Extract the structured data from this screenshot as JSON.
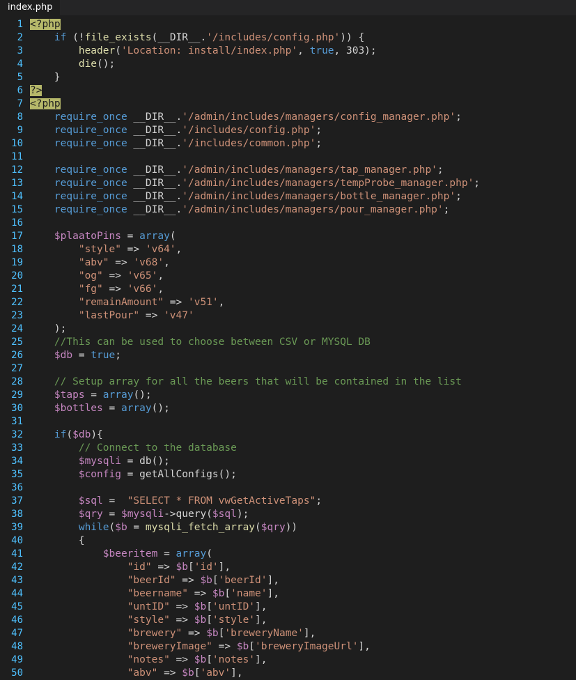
{
  "tab": {
    "title": "index.php"
  },
  "colors": {
    "background": "#1e1e1e",
    "tabbar": "#252526",
    "line_number": "#4fc1ff",
    "tag_highlight": "#b6b86a",
    "keyword": "#569cd6",
    "variable": "#c586c0",
    "function": "#dcdcaa",
    "string": "#ce9178",
    "comment": "#6a9955",
    "text": "#d4d4d4"
  },
  "lines": [
    {
      "n": "1",
      "tokens": [
        {
          "t": "tag",
          "v": "<?php"
        }
      ]
    },
    {
      "n": "2",
      "tokens": [
        {
          "t": "p",
          "v": "    "
        },
        {
          "t": "kw",
          "v": "if"
        },
        {
          "t": "p",
          "v": " (!"
        },
        {
          "t": "fn",
          "v": "file_exists"
        },
        {
          "t": "p",
          "v": "(__DIR__."
        },
        {
          "t": "str",
          "v": "'/includes/config.php'"
        },
        {
          "t": "p",
          "v": ")) {"
        }
      ]
    },
    {
      "n": "3",
      "tokens": [
        {
          "t": "p",
          "v": "        "
        },
        {
          "t": "fn",
          "v": "header"
        },
        {
          "t": "p",
          "v": "("
        },
        {
          "t": "str",
          "v": "'Location: install/index.php'"
        },
        {
          "t": "p",
          "v": ", "
        },
        {
          "t": "kw",
          "v": "true"
        },
        {
          "t": "p",
          "v": ", 303);"
        }
      ]
    },
    {
      "n": "4",
      "tokens": [
        {
          "t": "p",
          "v": "        "
        },
        {
          "t": "fn",
          "v": "die"
        },
        {
          "t": "p",
          "v": "();"
        }
      ]
    },
    {
      "n": "5",
      "tokens": [
        {
          "t": "p",
          "v": "    }"
        }
      ]
    },
    {
      "n": "6",
      "tokens": [
        {
          "t": "tag",
          "v": "?>"
        }
      ]
    },
    {
      "n": "7",
      "tokens": [
        {
          "t": "tag",
          "v": "<?php"
        }
      ]
    },
    {
      "n": "8",
      "tokens": [
        {
          "t": "p",
          "v": "    "
        },
        {
          "t": "kw",
          "v": "require_once"
        },
        {
          "t": "p",
          "v": " __DIR__."
        },
        {
          "t": "str",
          "v": "'/admin/includes/managers/config_manager.php'"
        },
        {
          "t": "p",
          "v": ";"
        }
      ]
    },
    {
      "n": "9",
      "tokens": [
        {
          "t": "p",
          "v": "    "
        },
        {
          "t": "kw",
          "v": "require_once"
        },
        {
          "t": "p",
          "v": " __DIR__."
        },
        {
          "t": "str",
          "v": "'/includes/config.php'"
        },
        {
          "t": "p",
          "v": ";"
        }
      ]
    },
    {
      "n": "10",
      "tokens": [
        {
          "t": "p",
          "v": "    "
        },
        {
          "t": "kw",
          "v": "require_once"
        },
        {
          "t": "p",
          "v": " __DIR__."
        },
        {
          "t": "str",
          "v": "'/includes/common.php'"
        },
        {
          "t": "p",
          "v": ";"
        }
      ]
    },
    {
      "n": "11",
      "tokens": []
    },
    {
      "n": "12",
      "tokens": [
        {
          "t": "p",
          "v": "    "
        },
        {
          "t": "kw",
          "v": "require_once"
        },
        {
          "t": "p",
          "v": " __DIR__."
        },
        {
          "t": "str",
          "v": "'/admin/includes/managers/tap_manager.php'"
        },
        {
          "t": "p",
          "v": ";"
        }
      ]
    },
    {
      "n": "13",
      "tokens": [
        {
          "t": "p",
          "v": "    "
        },
        {
          "t": "kw",
          "v": "require_once"
        },
        {
          "t": "p",
          "v": " __DIR__."
        },
        {
          "t": "str",
          "v": "'/admin/includes/managers/tempProbe_manager.php'"
        },
        {
          "t": "p",
          "v": ";"
        }
      ]
    },
    {
      "n": "14",
      "tokens": [
        {
          "t": "p",
          "v": "    "
        },
        {
          "t": "kw",
          "v": "require_once"
        },
        {
          "t": "p",
          "v": " __DIR__."
        },
        {
          "t": "str",
          "v": "'/admin/includes/managers/bottle_manager.php'"
        },
        {
          "t": "p",
          "v": ";"
        }
      ]
    },
    {
      "n": "15",
      "tokens": [
        {
          "t": "p",
          "v": "    "
        },
        {
          "t": "kw",
          "v": "require_once"
        },
        {
          "t": "p",
          "v": " __DIR__."
        },
        {
          "t": "str",
          "v": "'/admin/includes/managers/pour_manager.php'"
        },
        {
          "t": "p",
          "v": ";"
        }
      ]
    },
    {
      "n": "16",
      "tokens": []
    },
    {
      "n": "17",
      "tokens": [
        {
          "t": "p",
          "v": "    "
        },
        {
          "t": "var",
          "v": "$plaatoPins"
        },
        {
          "t": "p",
          "v": " = "
        },
        {
          "t": "kw",
          "v": "array"
        },
        {
          "t": "p",
          "v": "("
        }
      ]
    },
    {
      "n": "18",
      "tokens": [
        {
          "t": "p",
          "v": "        "
        },
        {
          "t": "str",
          "v": "\"style\""
        },
        {
          "t": "p",
          "v": " => "
        },
        {
          "t": "str",
          "v": "'v64'"
        },
        {
          "t": "p",
          "v": ","
        }
      ]
    },
    {
      "n": "19",
      "tokens": [
        {
          "t": "p",
          "v": "        "
        },
        {
          "t": "str",
          "v": "\"abv\""
        },
        {
          "t": "p",
          "v": " => "
        },
        {
          "t": "str",
          "v": "'v68'"
        },
        {
          "t": "p",
          "v": ","
        }
      ]
    },
    {
      "n": "20",
      "tokens": [
        {
          "t": "p",
          "v": "        "
        },
        {
          "t": "str",
          "v": "\"og\""
        },
        {
          "t": "p",
          "v": " => "
        },
        {
          "t": "str",
          "v": "'v65'"
        },
        {
          "t": "p",
          "v": ","
        }
      ]
    },
    {
      "n": "21",
      "tokens": [
        {
          "t": "p",
          "v": "        "
        },
        {
          "t": "str",
          "v": "\"fg\""
        },
        {
          "t": "p",
          "v": " => "
        },
        {
          "t": "str",
          "v": "'v66'"
        },
        {
          "t": "p",
          "v": ","
        }
      ]
    },
    {
      "n": "22",
      "tokens": [
        {
          "t": "p",
          "v": "        "
        },
        {
          "t": "str",
          "v": "\"remainAmount\""
        },
        {
          "t": "p",
          "v": " => "
        },
        {
          "t": "str",
          "v": "'v51'"
        },
        {
          "t": "p",
          "v": ","
        }
      ]
    },
    {
      "n": "23",
      "tokens": [
        {
          "t": "p",
          "v": "        "
        },
        {
          "t": "str",
          "v": "\"lastPour\""
        },
        {
          "t": "p",
          "v": " => "
        },
        {
          "t": "str",
          "v": "'v47'"
        }
      ]
    },
    {
      "n": "24",
      "tokens": [
        {
          "t": "p",
          "v": "    );"
        }
      ]
    },
    {
      "n": "25",
      "tokens": [
        {
          "t": "p",
          "v": "    "
        },
        {
          "t": "com",
          "v": "//This can be used to choose between CSV or MYSQL DB"
        }
      ]
    },
    {
      "n": "26",
      "tokens": [
        {
          "t": "p",
          "v": "    "
        },
        {
          "t": "var",
          "v": "$db"
        },
        {
          "t": "p",
          "v": " = "
        },
        {
          "t": "kw",
          "v": "true"
        },
        {
          "t": "p",
          "v": ";"
        }
      ]
    },
    {
      "n": "27",
      "tokens": []
    },
    {
      "n": "28",
      "tokens": [
        {
          "t": "p",
          "v": "    "
        },
        {
          "t": "com",
          "v": "// Setup array for all the beers that will be contained in the list"
        }
      ]
    },
    {
      "n": "29",
      "tokens": [
        {
          "t": "p",
          "v": "    "
        },
        {
          "t": "var",
          "v": "$taps"
        },
        {
          "t": "p",
          "v": " = "
        },
        {
          "t": "kw",
          "v": "array"
        },
        {
          "t": "p",
          "v": "();"
        }
      ]
    },
    {
      "n": "30",
      "tokens": [
        {
          "t": "p",
          "v": "    "
        },
        {
          "t": "var",
          "v": "$bottles"
        },
        {
          "t": "p",
          "v": " = "
        },
        {
          "t": "kw",
          "v": "array"
        },
        {
          "t": "p",
          "v": "();"
        }
      ]
    },
    {
      "n": "31",
      "tokens": []
    },
    {
      "n": "32",
      "tokens": [
        {
          "t": "p",
          "v": "    "
        },
        {
          "t": "kw",
          "v": "if"
        },
        {
          "t": "p",
          "v": "("
        },
        {
          "t": "var",
          "v": "$db"
        },
        {
          "t": "p",
          "v": "){"
        }
      ]
    },
    {
      "n": "33",
      "tokens": [
        {
          "t": "p",
          "v": "        "
        },
        {
          "t": "com",
          "v": "// Connect to the database"
        }
      ]
    },
    {
      "n": "34",
      "tokens": [
        {
          "t": "p",
          "v": "        "
        },
        {
          "t": "var",
          "v": "$mysqli"
        },
        {
          "t": "p",
          "v": " = db();"
        }
      ]
    },
    {
      "n": "35",
      "tokens": [
        {
          "t": "p",
          "v": "        "
        },
        {
          "t": "var",
          "v": "$config"
        },
        {
          "t": "p",
          "v": " = getAllConfigs();"
        }
      ]
    },
    {
      "n": "36",
      "tokens": []
    },
    {
      "n": "37",
      "tokens": [
        {
          "t": "p",
          "v": "        "
        },
        {
          "t": "var",
          "v": "$sql"
        },
        {
          "t": "p",
          "v": " =  "
        },
        {
          "t": "str",
          "v": "\"SELECT * FROM vwGetActiveTaps\""
        },
        {
          "t": "p",
          "v": ";"
        }
      ]
    },
    {
      "n": "38",
      "tokens": [
        {
          "t": "p",
          "v": "        "
        },
        {
          "t": "var",
          "v": "$qry"
        },
        {
          "t": "p",
          "v": " = "
        },
        {
          "t": "var",
          "v": "$mysqli"
        },
        {
          "t": "p",
          "v": "->query("
        },
        {
          "t": "var",
          "v": "$sql"
        },
        {
          "t": "p",
          "v": ");"
        }
      ]
    },
    {
      "n": "39",
      "tokens": [
        {
          "t": "p",
          "v": "        "
        },
        {
          "t": "kw",
          "v": "while"
        },
        {
          "t": "p",
          "v": "("
        },
        {
          "t": "var",
          "v": "$b"
        },
        {
          "t": "p",
          "v": " = "
        },
        {
          "t": "fn",
          "v": "mysqli_fetch_array"
        },
        {
          "t": "p",
          "v": "("
        },
        {
          "t": "var",
          "v": "$qry"
        },
        {
          "t": "p",
          "v": "))"
        }
      ]
    },
    {
      "n": "40",
      "tokens": [
        {
          "t": "p",
          "v": "        {"
        }
      ]
    },
    {
      "n": "41",
      "tokens": [
        {
          "t": "p",
          "v": "            "
        },
        {
          "t": "var",
          "v": "$beeritem"
        },
        {
          "t": "p",
          "v": " = "
        },
        {
          "t": "kw",
          "v": "array"
        },
        {
          "t": "p",
          "v": "("
        }
      ]
    },
    {
      "n": "42",
      "tokens": [
        {
          "t": "p",
          "v": "                "
        },
        {
          "t": "str",
          "v": "\"id\""
        },
        {
          "t": "p",
          "v": " => "
        },
        {
          "t": "var",
          "v": "$b"
        },
        {
          "t": "p",
          "v": "["
        },
        {
          "t": "str",
          "v": "'id'"
        },
        {
          "t": "p",
          "v": "],"
        }
      ]
    },
    {
      "n": "43",
      "tokens": [
        {
          "t": "p",
          "v": "                "
        },
        {
          "t": "str",
          "v": "\"beerId\""
        },
        {
          "t": "p",
          "v": " => "
        },
        {
          "t": "var",
          "v": "$b"
        },
        {
          "t": "p",
          "v": "["
        },
        {
          "t": "str",
          "v": "'beerId'"
        },
        {
          "t": "p",
          "v": "],"
        }
      ]
    },
    {
      "n": "44",
      "tokens": [
        {
          "t": "p",
          "v": "                "
        },
        {
          "t": "str",
          "v": "\"beername\""
        },
        {
          "t": "p",
          "v": " => "
        },
        {
          "t": "var",
          "v": "$b"
        },
        {
          "t": "p",
          "v": "["
        },
        {
          "t": "str",
          "v": "'name'"
        },
        {
          "t": "p",
          "v": "],"
        }
      ]
    },
    {
      "n": "45",
      "tokens": [
        {
          "t": "p",
          "v": "                "
        },
        {
          "t": "str",
          "v": "\"untID\""
        },
        {
          "t": "p",
          "v": " => "
        },
        {
          "t": "var",
          "v": "$b"
        },
        {
          "t": "p",
          "v": "["
        },
        {
          "t": "str",
          "v": "'untID'"
        },
        {
          "t": "p",
          "v": "],"
        }
      ]
    },
    {
      "n": "46",
      "tokens": [
        {
          "t": "p",
          "v": "                "
        },
        {
          "t": "str",
          "v": "\"style\""
        },
        {
          "t": "p",
          "v": " => "
        },
        {
          "t": "var",
          "v": "$b"
        },
        {
          "t": "p",
          "v": "["
        },
        {
          "t": "str",
          "v": "'style'"
        },
        {
          "t": "p",
          "v": "],"
        }
      ]
    },
    {
      "n": "47",
      "tokens": [
        {
          "t": "p",
          "v": "                "
        },
        {
          "t": "str",
          "v": "\"brewery\""
        },
        {
          "t": "p",
          "v": " => "
        },
        {
          "t": "var",
          "v": "$b"
        },
        {
          "t": "p",
          "v": "["
        },
        {
          "t": "str",
          "v": "'breweryName'"
        },
        {
          "t": "p",
          "v": "],"
        }
      ]
    },
    {
      "n": "48",
      "tokens": [
        {
          "t": "p",
          "v": "                "
        },
        {
          "t": "str",
          "v": "\"breweryImage\""
        },
        {
          "t": "p",
          "v": " => "
        },
        {
          "t": "var",
          "v": "$b"
        },
        {
          "t": "p",
          "v": "["
        },
        {
          "t": "str",
          "v": "'breweryImageUrl'"
        },
        {
          "t": "p",
          "v": "],"
        }
      ]
    },
    {
      "n": "49",
      "tokens": [
        {
          "t": "p",
          "v": "                "
        },
        {
          "t": "str",
          "v": "\"notes\""
        },
        {
          "t": "p",
          "v": " => "
        },
        {
          "t": "var",
          "v": "$b"
        },
        {
          "t": "p",
          "v": "["
        },
        {
          "t": "str",
          "v": "'notes'"
        },
        {
          "t": "p",
          "v": "],"
        }
      ]
    },
    {
      "n": "50",
      "tokens": [
        {
          "t": "p",
          "v": "                "
        },
        {
          "t": "str",
          "v": "\"abv\""
        },
        {
          "t": "p",
          "v": " => "
        },
        {
          "t": "var",
          "v": "$b"
        },
        {
          "t": "p",
          "v": "["
        },
        {
          "t": "str",
          "v": "'abv'"
        },
        {
          "t": "p",
          "v": "],"
        }
      ]
    }
  ]
}
